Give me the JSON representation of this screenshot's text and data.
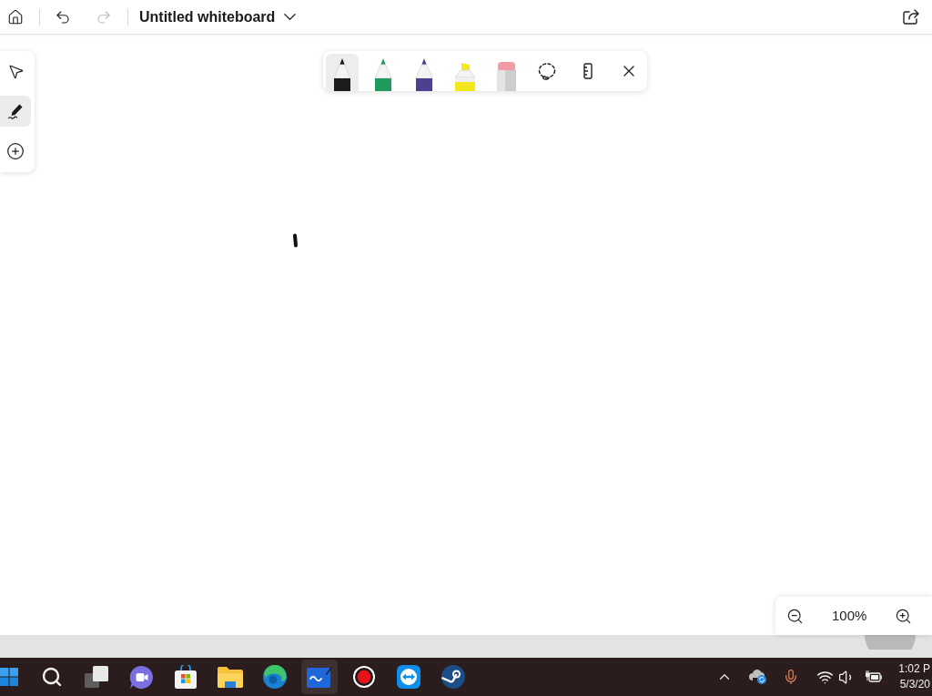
{
  "top_bar": {
    "undo": {
      "disabled": false
    },
    "redo": {
      "disabled": true
    },
    "title": "Untitled whiteboard"
  },
  "left_rail": {
    "tools": [
      {
        "kind": "select",
        "selected": false
      },
      {
        "kind": "pen",
        "selected": true
      },
      {
        "kind": "add",
        "selected": false
      }
    ]
  },
  "pen_toolbar": {
    "tools": [
      {
        "kind": "pen",
        "color": "#1c1c1c",
        "selected": true
      },
      {
        "kind": "pen",
        "color": "#1f9a5b",
        "selected": false
      },
      {
        "kind": "pen",
        "color": "#4e3f8f",
        "selected": false
      },
      {
        "kind": "highlighter",
        "color": "#f3e81c",
        "selected": false
      },
      {
        "kind": "eraser",
        "selected": false
      },
      {
        "kind": "lasso",
        "selected": false
      },
      {
        "kind": "ruler",
        "selected": false
      }
    ]
  },
  "zoom": {
    "value": "100%"
  },
  "taskbar": {
    "apps": [
      {
        "kind": "start",
        "selected": false
      },
      {
        "kind": "search",
        "selected": false
      },
      {
        "kind": "task_view",
        "selected": false
      },
      {
        "kind": "chat",
        "selected": false
      },
      {
        "kind": "store",
        "selected": false
      },
      {
        "kind": "files",
        "selected": false
      },
      {
        "kind": "browser",
        "selected": false
      },
      {
        "kind": "whiteboard",
        "selected": true
      },
      {
        "kind": "recorder",
        "selected": false
      },
      {
        "kind": "remote",
        "selected": false
      },
      {
        "kind": "games",
        "selected": false
      }
    ],
    "time": "1:02 P",
    "date": "5/3/20"
  }
}
